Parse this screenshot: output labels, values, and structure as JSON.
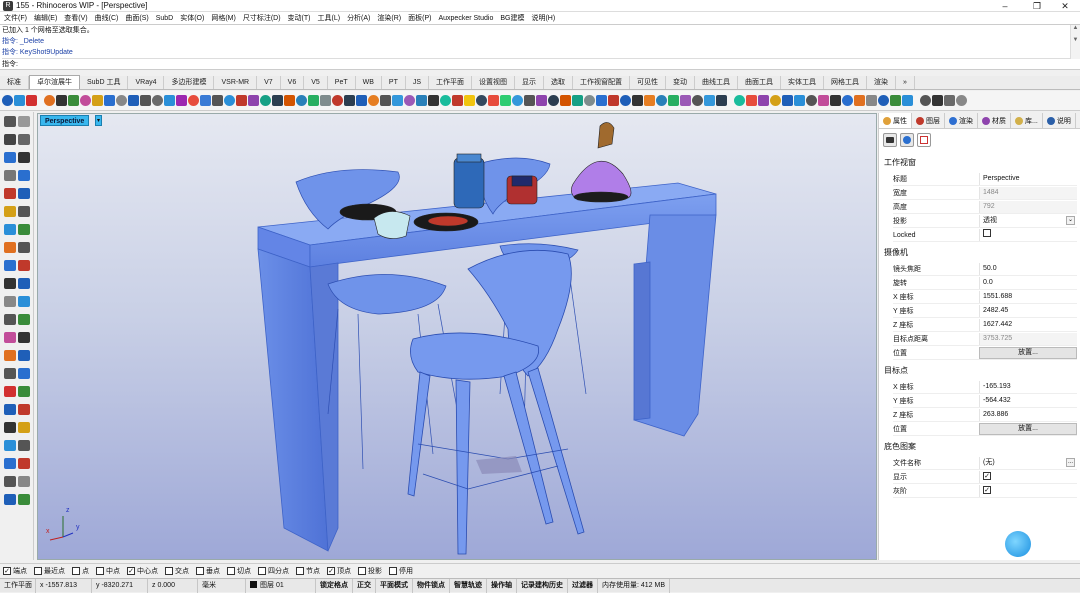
{
  "window": {
    "title": "155 - Rhinoceros WIP - [Perspective]"
  },
  "menu": [
    "文件(F)",
    "编辑(E)",
    "查看(V)",
    "曲线(C)",
    "曲面(S)",
    "SubD",
    "实体(O)",
    "网格(M)",
    "尺寸标注(D)",
    "变动(T)",
    "工具(L)",
    "分析(A)",
    "渲染(R)",
    "面板(P)",
    "Auxpecker Studio",
    "BG建模",
    "说明(H)"
  ],
  "command_history": [
    "已加入 1 个网格至选取集合。",
    "指令: _Delete",
    "指令: KeyShot9Update"
  ],
  "command_prompt": "指令:",
  "tabs": [
    "标准",
    "卓尔渲展牛",
    "SubD 工具",
    "VRay4",
    "多边形建模",
    "VSR-MR",
    "V7",
    "V6",
    "V5",
    "PeT",
    "WB",
    "PT",
    "JS",
    "工作平面",
    "设置视图",
    "显示",
    "选取",
    "工作视窗配置",
    "可见性",
    "变动",
    "曲线工具",
    "曲面工具",
    "实体工具",
    "网格工具",
    "渲染"
  ],
  "viewport": {
    "label": "Perspective",
    "menu_glyph": "▾"
  },
  "axes": {
    "x": "x",
    "y": "y",
    "z": "z"
  },
  "panel": {
    "tabs": [
      "属性",
      "图层",
      "渲染",
      "材质",
      "库...",
      "说明"
    ],
    "section_viewport": "工作视窗",
    "rows_viewport": [
      {
        "k": "标题",
        "v": "Perspective"
      },
      {
        "k": "宽度",
        "v": "1484"
      },
      {
        "k": "高度",
        "v": "792"
      },
      {
        "k": "投影",
        "v": "透视"
      },
      {
        "k": "Locked",
        "v": ""
      }
    ],
    "section_camera": "摄像机",
    "rows_camera": [
      {
        "k": "镜头焦距",
        "v": "50.0"
      },
      {
        "k": "旋转",
        "v": "0.0"
      },
      {
        "k": "X 座标",
        "v": "1551.688"
      },
      {
        "k": "Y 座标",
        "v": "2482.45"
      },
      {
        "k": "Z 座标",
        "v": "1627.442"
      },
      {
        "k": "目标点距离",
        "v": "3753.725"
      },
      {
        "k": "位置",
        "v": "放置..."
      }
    ],
    "section_target": "目标点",
    "rows_target": [
      {
        "k": "X 座标",
        "v": "-165.193"
      },
      {
        "k": "Y 座标",
        "v": "-564.432"
      },
      {
        "k": "Z 座标",
        "v": "263.886"
      },
      {
        "k": "位置",
        "v": "放置..."
      }
    ],
    "section_wallpaper": "底色图案",
    "rows_wallpaper": [
      {
        "k": "文件名称",
        "v": "(无)"
      },
      {
        "k": "显示",
        "v": ""
      },
      {
        "k": "灰阶",
        "v": ""
      }
    ],
    "dots": "..."
  },
  "osnap": [
    {
      "label": "端点",
      "checked": true
    },
    {
      "label": "最近点",
      "checked": false
    },
    {
      "label": "点",
      "checked": false
    },
    {
      "label": "中点",
      "checked": false
    },
    {
      "label": "中心点",
      "checked": true
    },
    {
      "label": "交点",
      "checked": false
    },
    {
      "label": "垂点",
      "checked": false
    },
    {
      "label": "切点",
      "checked": false
    },
    {
      "label": "四分点",
      "checked": false
    },
    {
      "label": "节点",
      "checked": false
    },
    {
      "label": "顶点",
      "checked": true
    },
    {
      "label": "投影",
      "checked": false
    },
    {
      "label": "停用",
      "checked": false
    }
  ],
  "status": [
    "工作平面",
    "x -1557.813",
    "y -8320.271",
    "z 0.000",
    "毫米",
    "图层 01",
    "锁定格点",
    "正交",
    "平面模式",
    "物件锁点",
    "智慧轨迹",
    "操作轴",
    "记录建构历史",
    "过滤器",
    "内存使用量: 412 MB"
  ],
  "colors": {
    "accent": "#39b7ee",
    "viewport_bottom": "#9ea8d7",
    "model_blue": "#6d90e8"
  }
}
